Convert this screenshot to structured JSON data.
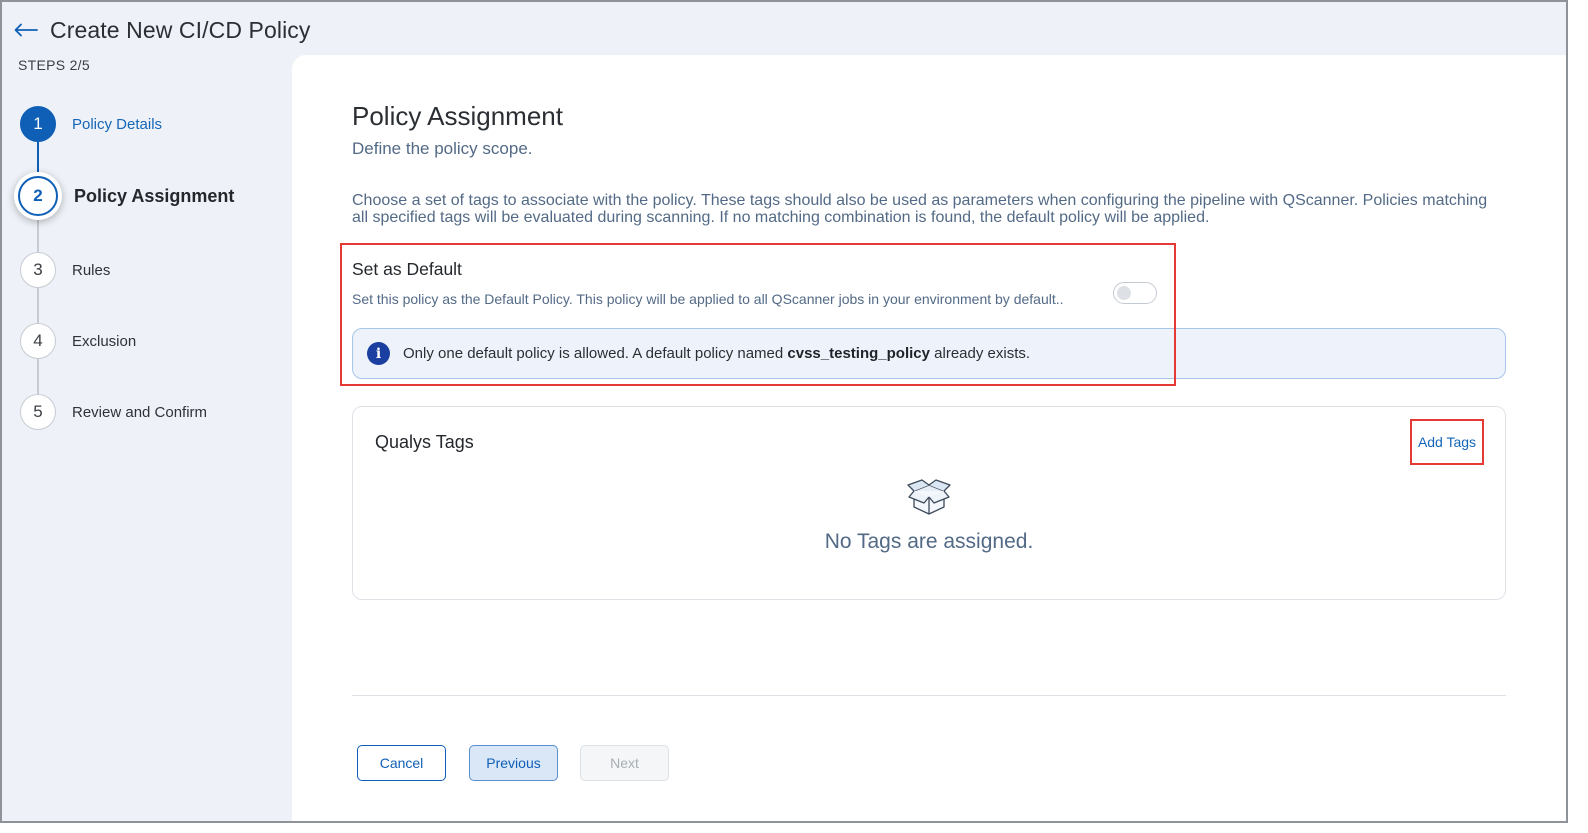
{
  "header": {
    "title": "Create New CI/CD Policy",
    "steps_counter": "STEPS 2/5"
  },
  "stepper": {
    "steps": [
      {
        "number": "1",
        "label": "Policy Details",
        "state": "completed"
      },
      {
        "number": "2",
        "label": "Policy Assignment",
        "state": "active"
      },
      {
        "number": "3",
        "label": "Rules",
        "state": "pending"
      },
      {
        "number": "4",
        "label": "Exclusion",
        "state": "pending"
      },
      {
        "number": "5",
        "label": "Review and Confirm",
        "state": "pending"
      }
    ]
  },
  "main": {
    "title": "Policy Assignment",
    "subtitle": "Define the policy scope.",
    "description": "Choose a set of tags to associate with the policy. These tags should also be used as parameters when configuring the pipeline with QScanner. Policies matching all specified tags will be evaluated during scanning. If no matching combination is found, the default policy will be applied.",
    "set_default": {
      "title": "Set as Default",
      "description": "Set this policy as the Default Policy. This policy will be applied to all QScanner jobs in your environment by default..",
      "toggle_on": false
    },
    "info_banner": {
      "prefix": "Only one default policy is allowed. A default policy named ",
      "policy_name": "cvss_testing_policy",
      "suffix": " already exists."
    },
    "tags": {
      "title": "Qualys Tags",
      "add_label": "Add Tags",
      "empty_text": "No Tags are assigned."
    }
  },
  "footer": {
    "cancel_label": "Cancel",
    "previous_label": "Previous",
    "next_label": "Next"
  },
  "colors": {
    "primary": "#0f5fb6",
    "highlight": "#e53935",
    "muted_text": "#536a86",
    "page_bg": "#eef2f8"
  }
}
